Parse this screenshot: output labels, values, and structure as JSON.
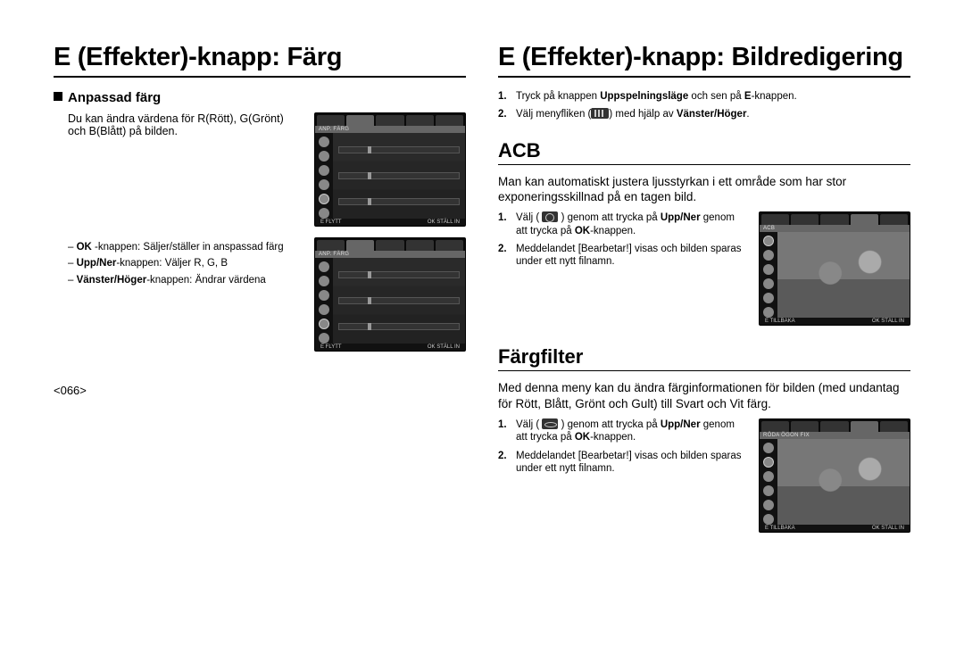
{
  "left": {
    "title": "E (Effekter)-knapp: Färg",
    "custom_color_heading": "Anpassad färg",
    "custom_color_intro": "Du kan ändra värdena för R(Rött), G(Grönt) och B(Blått) på bilden.",
    "legend": {
      "ok_bold": "OK",
      "ok_suffix": "-knappen:",
      "ok_desc": "Säljer/ställer in anspassad färg",
      "updown_bold": "Upp/Ner",
      "updown_suffix": "-knappen:",
      "updown_desc": "Väljer R, G, B",
      "lr_bold": "Vänster/Höger",
      "lr_suffix": "-knappen:",
      "lr_desc": "Ändrar värdena"
    },
    "thumb": {
      "label": "ANP. FÄRG",
      "bot_left": "E    FLYTT",
      "bot_right": "OK   STÄLL IN"
    }
  },
  "right": {
    "title": "E (Effekter)-knapp: Bildredigering",
    "intro": [
      {
        "num": "1.",
        "t1": "Tryck på knappen ",
        "b1": "Uppspelningsläge",
        "t2": " och sen på ",
        "b2": "E",
        "t3": "-knappen."
      },
      {
        "num": "2.",
        "t1": "Välj menyfliken (",
        "t2": ") med hjälp av ",
        "b1": "Vänster/Höger",
        "t3": "."
      }
    ],
    "acb": {
      "heading": "ACB",
      "desc": "Man kan automatiskt justera ljusstyrkan i ett område som har stor exponeringsskillnad på en tagen bild.",
      "steps": [
        {
          "num": "1.",
          "t1": "Välj ( ",
          "t2": " ) genom att trycka på ",
          "b1": "Upp/Ner",
          "t3": " genom att trycka på ",
          "b2": "OK",
          "t4": "-knappen."
        },
        {
          "num": "2.",
          "t1": "Meddelandet [Bearbetar!] visas och bilden sparas under ett nytt filnamn."
        }
      ],
      "thumb": {
        "label": "ACB",
        "bot_left": "E    TILLBAKA",
        "bot_right": "OK   STÄLL IN"
      }
    },
    "filter": {
      "heading": "Färgfilter",
      "desc": "Med denna meny kan du ändra färginformationen för bilden (med undantag för Rött, Blått, Grönt och Gult) till Svart och Vit färg.",
      "steps": [
        {
          "num": "1.",
          "t1": "Välj ( ",
          "t2": " ) genom att trycka på ",
          "b1": "Upp/Ner",
          "t3": " genom att trycka på ",
          "b2": "OK",
          "t4": "-knappen."
        },
        {
          "num": "2.",
          "t1": "Meddelandet [Bearbetar!] visas och bilden sparas under ett nytt filnamn."
        }
      ],
      "thumb": {
        "label": "RÖDA ÖGON FIX",
        "bot_left": "E    TILLBAKA",
        "bot_right": "OK   STÄLL IN"
      }
    }
  },
  "page_number": "<066>"
}
